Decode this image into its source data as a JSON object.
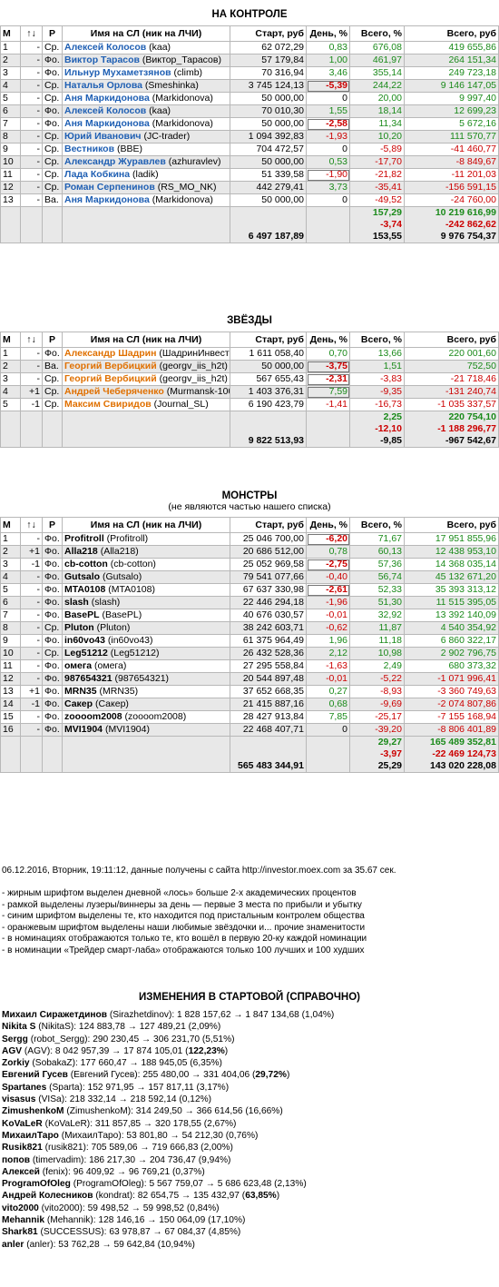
{
  "headers": [
    "M",
    "↑↓",
    "Р",
    "Имя на СЛ (ник на ЛЧИ)",
    "Старт, руб",
    "День, %",
    "Всего, %",
    "Всего, руб"
  ],
  "control": {
    "title": "НА КОНТРОЛЕ",
    "rows": [
      {
        "m": "1",
        "ch": "-",
        "p": "Ср.",
        "name": "Алексей Колосов",
        "nick": "(kaa)",
        "start": "62 072,29",
        "day": "0,83",
        "tp": "676,08",
        "tr": "419 655,86",
        "dc": "green",
        "tc": "green",
        "trc": "green"
      },
      {
        "m": "2",
        "ch": "-",
        "p": "Фо.",
        "name": "Виктор Тарасов",
        "nick": "(Виктор_Тарасов)",
        "start": "57 179,84",
        "day": "1,00",
        "tp": "461,97",
        "tr": "264 151,34",
        "dc": "green",
        "tc": "green",
        "trc": "green"
      },
      {
        "m": "3",
        "ch": "-",
        "p": "Фо.",
        "name": "Ильнур Мухаметзянов",
        "nick": "(climb)",
        "start": "70 316,94",
        "day": "3,46",
        "tp": "355,14",
        "tr": "249 723,18",
        "dc": "green",
        "tc": "green",
        "trc": "green"
      },
      {
        "m": "4",
        "ch": "-",
        "p": "Ср.",
        "name": "Наталья Орлова",
        "nick": "(Smeshinka)",
        "start": "3 745 124,13",
        "day": "-5,39",
        "tp": "244,22",
        "tr": "9 146 147,05",
        "dc": "redb",
        "tc": "green",
        "trc": "green"
      },
      {
        "m": "5",
        "ch": "-",
        "p": "Ср.",
        "name": "Аня Маркидонова",
        "nick": "(Markidonova)",
        "start": "50 000,00",
        "day": "0",
        "tp": "20,00",
        "tr": "9 997,40",
        "dc": "",
        "tc": "green",
        "trc": "green"
      },
      {
        "m": "6",
        "ch": "-",
        "p": "Фо.",
        "name": "Алексей Колосов",
        "nick": "(kaa)",
        "start": "70 010,30",
        "day": "1,55",
        "tp": "18,14",
        "tr": "12 699,23",
        "dc": "green",
        "tc": "green",
        "trc": "green"
      },
      {
        "m": "7",
        "ch": "-",
        "p": "Фо.",
        "name": "Аня Маркидонова",
        "nick": "(Markidonova)",
        "start": "50 000,00",
        "day": "-2,58",
        "tp": "11,34",
        "tr": "5 672,16",
        "dc": "redb",
        "tc": "green",
        "trc": "green"
      },
      {
        "m": "8",
        "ch": "-",
        "p": "Ср.",
        "name": "Юрий Иванович",
        "nick": "(JC-trader)",
        "start": "1 094 392,83",
        "day": "-1,93",
        "tp": "10,20",
        "tr": "111 570,77",
        "dc": "red",
        "tc": "green",
        "trc": "green"
      },
      {
        "m": "9",
        "ch": "-",
        "p": "Ср.",
        "name": "Вестников",
        "nick": "(BBE)",
        "start": "704 472,57",
        "day": "0",
        "tp": "-5,89",
        "tr": "-41 460,77",
        "dc": "",
        "tc": "red",
        "trc": "red"
      },
      {
        "m": "10",
        "ch": "-",
        "p": "Ср.",
        "name": "Александр Журавлев",
        "nick": "(azhuravlev)",
        "start": "50 000,00",
        "day": "0,53",
        "tp": "-17,70",
        "tr": "-8 849,67",
        "dc": "green",
        "tc": "red",
        "trc": "red"
      },
      {
        "m": "11",
        "ch": "-",
        "p": "Ср.",
        "name": "Лада Кобкина",
        "nick": "(ladik)",
        "start": "51 339,58",
        "day": "-1,90",
        "tp": "-21,82",
        "tr": "-11 201,03",
        "dc": "red",
        "tc": "red",
        "trc": "red"
      },
      {
        "m": "12",
        "ch": "-",
        "p": "Ср.",
        "name": "Роман Серпенинов",
        "nick": "(RS_MO_NK)",
        "start": "442 279,41",
        "day": "3,73",
        "tp": "-35,41",
        "tr": "-156 591,15",
        "dc": "green",
        "tc": "red",
        "trc": "red"
      },
      {
        "m": "13",
        "ch": "-",
        "p": "Ва.",
        "name": "Аня Маркидонова",
        "nick": "(Markidonova)",
        "start": "50 000,00",
        "day": "0",
        "tp": "-49,52",
        "tr": "-24 760,00",
        "dc": "",
        "tc": "red",
        "trc": "red"
      }
    ],
    "totals": {
      "start": "6 497 187,89",
      "day": [
        "157,29",
        "-3,74",
        "153,55"
      ],
      "total": [
        "10 219 616,99",
        "-242 862,62",
        "9 976 754,37"
      ]
    }
  },
  "stars": {
    "title": "ЗВЁЗДЫ",
    "rows": [
      {
        "m": "1",
        "ch": "-",
        "p": "Фо.",
        "name": "Александр Шадрин",
        "nick": "(ШадринИнвест)",
        "start": "1 611 058,40",
        "day": "0,70",
        "tp": "13,66",
        "tr": "220 001,60",
        "dc": "green",
        "tc": "green",
        "trc": "green"
      },
      {
        "m": "2",
        "ch": "-",
        "p": "Ва.",
        "name": "Георгий Вербицкий",
        "nick": "(georgv_iis_h2t)",
        "start": "50 000,00",
        "day": "-3,75",
        "tp": "1,51",
        "tr": "752,50",
        "dc": "redb",
        "tc": "green",
        "trc": "green"
      },
      {
        "m": "3",
        "ch": "-",
        "p": "Ср.",
        "name": "Георгий Вербицкий",
        "nick": "(georgv_iis_h2t)",
        "start": "567 655,43",
        "day": "-2,31",
        "tp": "-3,83",
        "tr": "-21 718,46",
        "dc": "redb",
        "tc": "red",
        "trc": "red"
      },
      {
        "m": "4",
        "ch": "+1",
        "p": "Ср.",
        "name": "Андрей Чеберяченко",
        "nick": "(Murmansk-100)",
        "start": "1 403 376,31",
        "day": "7,59",
        "tp": "-9,35",
        "tr": "-131 240,74",
        "dc": "green",
        "tc": "red",
        "trc": "red"
      },
      {
        "m": "5",
        "ch": "-1",
        "p": "Ср.",
        "name": "Максим Свиридов",
        "nick": "(Journal_SL)",
        "start": "6 190 423,79",
        "day": "-1,41",
        "tp": "-16,73",
        "tr": "-1 035 337,57",
        "dc": "red",
        "tc": "red",
        "trc": "red"
      }
    ],
    "totals": {
      "start": "9 822 513,93",
      "day": [
        "2,25",
        "-12,10",
        "-9,85"
      ],
      "total": [
        "220 754,10",
        "-1 188 296,77",
        "-967 542,67"
      ]
    }
  },
  "monsters": {
    "title": "МОНСТРЫ",
    "subtitle": "(не являются частью нашего списка)",
    "rows": [
      {
        "m": "1",
        "ch": "-",
        "p": "Фо.",
        "name": "Profitroll",
        "nick": "(Profitroll)",
        "start": "25 046 700,00",
        "day": "-6,20",
        "tp": "71,67",
        "tr": "17 951 855,96",
        "dc": "redb",
        "tc": "green",
        "trc": "green"
      },
      {
        "m": "2",
        "ch": "+1",
        "p": "Фо.",
        "name": "Alla218",
        "nick": "(Alla218)",
        "start": "20 686 512,00",
        "day": "0,78",
        "tp": "60,13",
        "tr": "12 438 953,10",
        "dc": "green",
        "tc": "green",
        "trc": "green"
      },
      {
        "m": "3",
        "ch": "-1",
        "p": "Фо.",
        "name": "cb-cotton",
        "nick": "(cb-cotton)",
        "start": "25 052 969,58",
        "day": "-2,75",
        "tp": "57,36",
        "tr": "14 368 035,14",
        "dc": "redb",
        "tc": "green",
        "trc": "green"
      },
      {
        "m": "4",
        "ch": "-",
        "p": "Фо.",
        "name": "Gutsalo",
        "nick": "(Gutsalo)",
        "start": "79 541 077,66",
        "day": "-0,40",
        "tp": "56,74",
        "tr": "45 132 671,20",
        "dc": "red",
        "tc": "green",
        "trc": "green"
      },
      {
        "m": "5",
        "ch": "-",
        "p": "Фо.",
        "name": "MTA0108",
        "nick": "(MTA0108)",
        "start": "67 637 330,98",
        "day": "-2,61",
        "tp": "52,33",
        "tr": "35 393 313,12",
        "dc": "redb",
        "tc": "green",
        "trc": "green"
      },
      {
        "m": "6",
        "ch": "-",
        "p": "Фо.",
        "name": "slash",
        "nick": "(slash)",
        "start": "22 446 294,18",
        "day": "-1,96",
        "tp": "51,30",
        "tr": "11 515 395,05",
        "dc": "red",
        "tc": "green",
        "trc": "green"
      },
      {
        "m": "7",
        "ch": "-",
        "p": "Фо.",
        "name": "BasePL",
        "nick": "(BasePL)",
        "start": "40 676 030,57",
        "day": "-0,01",
        "tp": "32,92",
        "tr": "13 392 140,09",
        "dc": "red",
        "tc": "green",
        "trc": "green"
      },
      {
        "m": "8",
        "ch": "-",
        "p": "Ср.",
        "name": "Pluton",
        "nick": "(Pluton)",
        "start": "38 242 603,71",
        "day": "-0,62",
        "tp": "11,87",
        "tr": "4 540 354,92",
        "dc": "red",
        "tc": "green",
        "trc": "green"
      },
      {
        "m": "9",
        "ch": "-",
        "p": "Фо.",
        "name": "in60vo43",
        "nick": "(in60vo43)",
        "start": "61 375 964,49",
        "day": "1,96",
        "tp": "11,18",
        "tr": "6 860 322,17",
        "dc": "green",
        "tc": "green",
        "trc": "green"
      },
      {
        "m": "10",
        "ch": "-",
        "p": "Ср.",
        "name": "Leg51212",
        "nick": "(Leg51212)",
        "start": "26 432 528,36",
        "day": "2,12",
        "tp": "10,98",
        "tr": "2 902 796,75",
        "dc": "green",
        "tc": "green",
        "trc": "green"
      },
      {
        "m": "11",
        "ch": "-",
        "p": "Фо.",
        "name": "омега",
        "nick": "(омега)",
        "start": "27 295 558,84",
        "day": "-1,63",
        "tp": "2,49",
        "tr": "680 373,32",
        "dc": "red",
        "tc": "green",
        "trc": "green"
      },
      {
        "m": "12",
        "ch": "-",
        "p": "Фо.",
        "name": "987654321",
        "nick": "(987654321)",
        "start": "20 544 897,48",
        "day": "-0,01",
        "tp": "-5,22",
        "tr": "-1 071 996,41",
        "dc": "red",
        "tc": "red",
        "trc": "red"
      },
      {
        "m": "13",
        "ch": "+1",
        "p": "Фо.",
        "name": "MRN35",
        "nick": "(MRN35)",
        "start": "37 652 668,35",
        "day": "0,27",
        "tp": "-8,93",
        "tr": "-3 360 749,63",
        "dc": "green",
        "tc": "red",
        "trc": "red"
      },
      {
        "m": "14",
        "ch": "-1",
        "p": "Фо.",
        "name": "Сакер",
        "nick": "(Сакер)",
        "start": "21 415 887,16",
        "day": "0,68",
        "tp": "-9,69",
        "tr": "-2 074 807,86",
        "dc": "green",
        "tc": "red",
        "trc": "red"
      },
      {
        "m": "15",
        "ch": "-",
        "p": "Фо.",
        "name": "zoooom2008",
        "nick": "(zoooom2008)",
        "start": "28 427 913,84",
        "day": "7,85",
        "tp": "-25,17",
        "tr": "-7 155 168,94",
        "dc": "green",
        "tc": "red",
        "trc": "red"
      },
      {
        "m": "16",
        "ch": "-",
        "p": "Фо.",
        "name": "MVI1904",
        "nick": "(MVI1904)",
        "start": "22 468 407,71",
        "day": "0",
        "tp": "-39,20",
        "tr": "-8 806 401,89",
        "dc": "",
        "tc": "red",
        "trc": "red"
      }
    ],
    "totals": {
      "start": "565 483 344,91",
      "day": [
        "29,27",
        "-3,97",
        "25,29"
      ],
      "total": [
        "165 489 352,81",
        "-22 469 124,73",
        "143 020 228,08"
      ]
    }
  },
  "footer": {
    "timestamp": "06.12.2016, Вторник, 19:11:12, данные получены с сайта http://investor.moex.com за 35.67 сек.",
    "notes": [
      "- жирным шрифтом выделен дневной «лось» больше 2-х академических процентов",
      "- рамкой выделены лузеры/виннеры за день — первые 3 места по прибыли и убытку",
      "- синим шрифтом выделены те, кто находится под пристальным контролем общества",
      "- оранжевым шрифтом выделены наши любимые звёздочки и... прочие знаменитости",
      "- в номинациях отображаются только те, кто вошёл в первую 20-ку каждой номинации",
      "- в номинации «Трейдер смарт-лаба» отображаются только 100 лучших и 100 худших"
    ]
  },
  "changes": {
    "title": "ИЗМЕНЕНИЯ В СТАРТОВОЙ (СПРАВОЧНО)",
    "items": [
      {
        "name": "Михаил Сиражетдинов",
        "rest": " (Sirazhetdinov): 1 828 157,62 → 1 847 134,68 (1,04%)",
        "pct": ""
      },
      {
        "name": "Nikita S",
        "rest": " (NikitaS): 124 883,78 → 127 489,21 (2,09%)",
        "pct": ""
      },
      {
        "name": "Sergg",
        "rest": " (robot_Sergg): 290 230,45 → 306 231,70 (5,51%)",
        "pct": ""
      },
      {
        "name": "AGV",
        "rest": " (AGV): 8 042 957,39 → 17 874 105,01 (",
        "pct": "122,23%",
        "tail": ")"
      },
      {
        "name": "Zorkiy",
        "rest": " (SobakaZ): 177 660,47 → 188 945,05 (6,35%)",
        "pct": ""
      },
      {
        "name": "Евгений Гусев",
        "rest": " (Евгений Гусев): 255 480,00 → 331 404,06 (",
        "pct": "29,72%",
        "tail": ")"
      },
      {
        "name": "Spartanes",
        "rest": " (Sparta): 152 971,95 → 157 817,11 (3,17%)",
        "pct": ""
      },
      {
        "name": "visasus",
        "rest": " (VISa): 218 332,14 → 218 592,14 (0,12%)",
        "pct": ""
      },
      {
        "name": "ZimushenkoM",
        "rest": " (ZimushenkoM): 314 249,50 → 366 614,56 (16,66%)",
        "pct": ""
      },
      {
        "name": "KoVaLeR",
        "rest": " (KoVaLeR): 311 857,85 → 320 178,55 (2,67%)",
        "pct": ""
      },
      {
        "name": "МихаилТаро",
        "rest": " (МихаилТаро): 53 801,80 → 54 212,30 (0,76%)",
        "pct": ""
      },
      {
        "name": "Rusik821",
        "rest": " (rusik821): 705 589,06 → 719 666,83 (2,00%)",
        "pct": ""
      },
      {
        "name": "попов",
        "rest": " (timervadim): 186 217,30 → 204 736,47 (9,94%)",
        "pct": ""
      },
      {
        "name": "Алексей",
        "rest": " (fenix): 96 409,92 → 96 769,21 (0,37%)",
        "pct": ""
      },
      {
        "name": "ProgramOfOleg",
        "rest": " (ProgramOfOleg): 5 567 759,07 → 5 686 623,48 (2,13%)",
        "pct": ""
      },
      {
        "name": "Андрей Колесников",
        "rest": " (kondrat): 82 654,75 → 135 432,97 (",
        "pct": "63,85%",
        "tail": ")"
      },
      {
        "name": "vito2000",
        "rest": " (vito2000): 59 498,52 → 59 998,52 (0,84%)",
        "pct": ""
      },
      {
        "name": "Mehannik",
        "rest": " (Mehannik): 128 146,16 → 150 064,09 (17,10%)",
        "pct": ""
      },
      {
        "name": "Shark81",
        "rest": " (SUCCESSUS): 63 978,87 → 67 084,37 (4,85%)",
        "pct": ""
      },
      {
        "name": "anler",
        "rest": " (anler): 53 762,28 → 59 642,84 (10,94%)",
        "pct": ""
      }
    ]
  },
  "colors": {
    "blue": "#1f5fb3",
    "orange": "#e07000",
    "green": "#1a8a1a",
    "red": "#cc0000",
    "shade": "#e8e8e8"
  }
}
